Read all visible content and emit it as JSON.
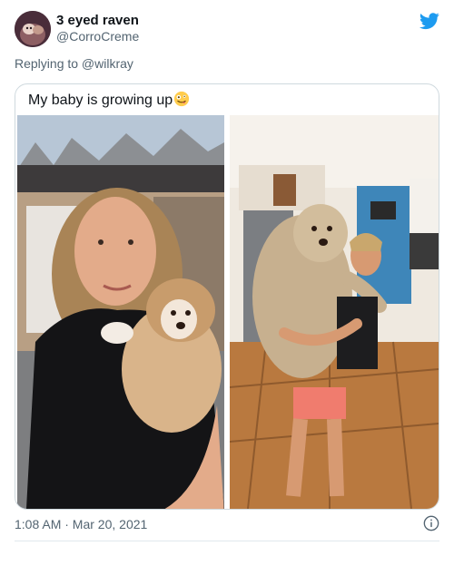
{
  "author": {
    "display_name": "3 eyed raven",
    "handle": "@CorroCreme",
    "avatar_icon": "avatar-image"
  },
  "reply": {
    "text": "Replying to @wilkray"
  },
  "quoted": {
    "text": "My baby is growing up",
    "emoji_icon": "zany-face-emoji",
    "photos": [
      {
        "name": "woman-holding-puppy-photo"
      },
      {
        "name": "woman-holding-grown-dog-photo"
      }
    ]
  },
  "meta": {
    "timestamp": "1:08 AM · Mar 20, 2021"
  },
  "colors": {
    "brand": "#1d9bf0",
    "text": "#0f1419",
    "muted": "#536471",
    "border": "#cfd9de"
  }
}
